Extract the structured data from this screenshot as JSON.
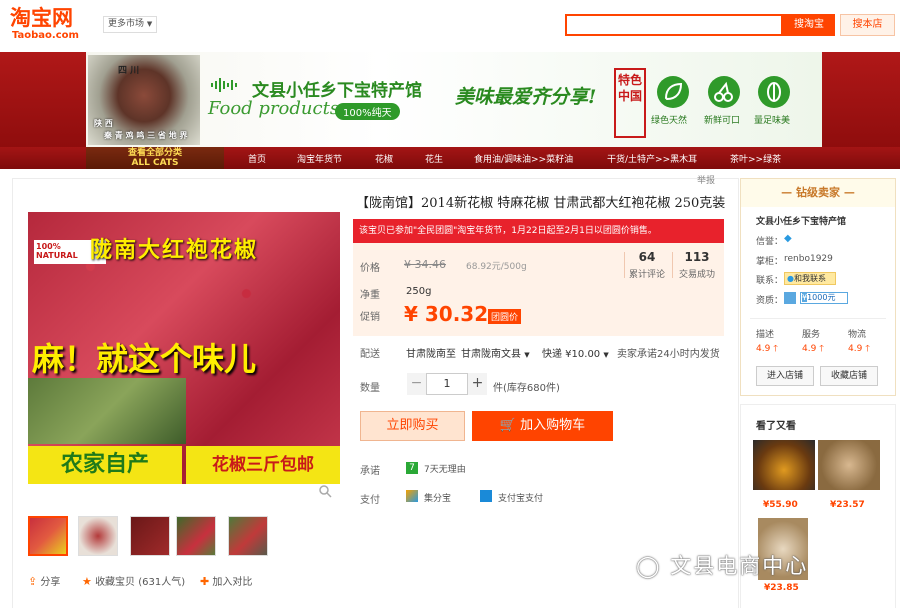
{
  "header": {
    "logo": "淘宝网",
    "logo_sub": "Taobao.com",
    "market": "更多市场",
    "search_value": "",
    "search_btn": "搜淘宝",
    "search_shop_btn": "搜本店"
  },
  "banner": {
    "rooster_line1": "四 川",
    "rooster_line2": "陕 西",
    "rooster_line3": "秦 青 鸡 鸣 三 省 地 界",
    "shop_title": "文县小任乡下宝特产馆",
    "food_products": "Food products",
    "badge": "100%纯天",
    "slogan": "美味最爱齐分享!",
    "seal": "特色中国",
    "features": [
      "绿色天然",
      "新鲜可口",
      "量足味美"
    ]
  },
  "nav": {
    "all_cats_cn": "查看全部分类",
    "all_cats_en": "ALL CATS",
    "items": [
      "首页",
      "淘宝年货节",
      "花椒",
      "花生",
      "食用油/调味油>>菜籽油",
      "干货/土特产>>黑木耳",
      "茶叶>>绿茶"
    ]
  },
  "report": "举报",
  "product": {
    "title": "【陇南馆】2014新花椒 特麻花椒 甘肃武都大红袍花椒 250克装",
    "promo": "该宝贝已参加\"全民团圆\"淘宝年货节，1月22日起至2月1日以团圆价销售。",
    "price_label": "价格",
    "old_price": "¥ 34.46",
    "unit_price": "68.92元/500g",
    "reviews_num": "64",
    "reviews_label": "累计评论",
    "sales_num": "113",
    "sales_label": "交易成功",
    "weight_label": "净重",
    "weight": "250g",
    "promo_price_label": "促销",
    "promo_price": "¥ 30.32",
    "group_tag": "团圆价",
    "delivery_label": "配送",
    "delivery_from": "甘肃陇南",
    "delivery_to_word": "至",
    "delivery_to": "甘肃陇南文县",
    "express": "快递 ¥10.00",
    "ship_note": "卖家承诺24小时内发货",
    "qty_label": "数量",
    "qty_minus": "−",
    "qty_value": "1",
    "qty_plus": "+",
    "stock": "件(库存680件)",
    "buy_now": "立即购买",
    "add_cart": "加入购物车",
    "promise_label": "承诺",
    "promise_icon": "7",
    "promise": "7天无理由",
    "pay_label": "支付",
    "pay1": "集分宝",
    "pay2": "支付宝支付",
    "image": {
      "natural": "100% NATURAL",
      "title": "陇南大红袍花椒",
      "mid": "麻！就这个味儿",
      "bottom_left": "农家自产",
      "bottom_right": "花椒三斤包邮"
    },
    "share": "分享",
    "fav": "收藏宝贝",
    "fav_count": "(631人气)",
    "compare": "加入对比"
  },
  "seller": {
    "title": "钻级卖家",
    "shop": "文县小任乡下宝特产馆",
    "credit_label": "信誉：",
    "owner_label": "掌柜：",
    "owner": "renbo1929",
    "contact_label": "联系：",
    "contact": "和我联系",
    "qual_label": "资质：",
    "qual_value": "1000元",
    "ratings": [
      {
        "label": "描述",
        "value": "4.9"
      },
      {
        "label": "服务",
        "value": "4.9"
      },
      {
        "label": "物流",
        "value": "4.9"
      }
    ],
    "enter_shop": "进入店铺",
    "fav_shop": "收藏店铺"
  },
  "also_viewed": {
    "title": "看了又看",
    "items": [
      {
        "price": "¥55.90"
      },
      {
        "price": "¥23.57"
      },
      {
        "price": "¥23.85"
      }
    ]
  },
  "watermark": "文县电商中心",
  "colors": {
    "accent": "#ff4400",
    "banner_red": "#a41515",
    "green": "#2f9a2a"
  }
}
